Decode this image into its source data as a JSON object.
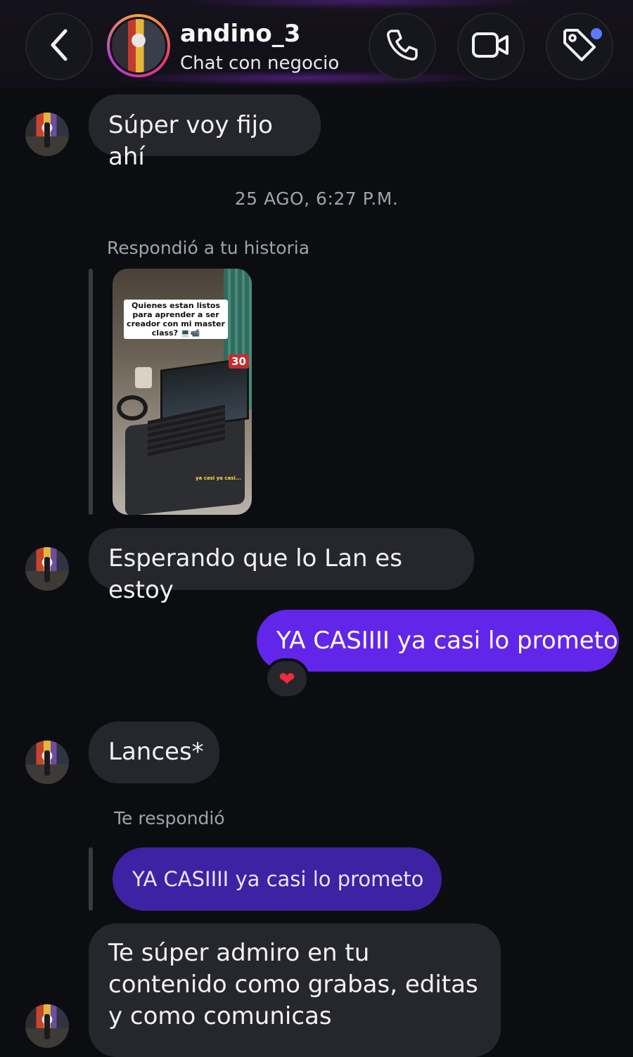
{
  "header": {
    "username": "andino_3",
    "subtitle": "Chat con negocio"
  },
  "messages": {
    "m1": "Súper voy fijo ahí",
    "timestamp": "25 AGO, 6:27 P.M.",
    "story_reply_label": "Respondió a tu historia",
    "story_caption": "Quienes estan listos para aprender a ser creador con mi master class? 💻📹",
    "story_badge": "30",
    "story_small_caption": "ya casi ya casi...",
    "m2": "Esperando que lo Lan es estoy",
    "m3_out": "YA CASIIII ya casi lo prometo",
    "reaction": "❤",
    "m4": "Lances*",
    "reply_label": "Te respondió",
    "quoted_out": "YA CASIIII ya casi lo prometo",
    "m5": "Te súper admiro en tu contenido como grabas, editas y como comunicas"
  },
  "colors": {
    "background": "#0c0d11",
    "incoming_bubble": "#26272c",
    "outgoing_bubble": "#6226ea",
    "quoted_bubble": "#3d22a3",
    "notification_dot": "#5b7bff"
  }
}
